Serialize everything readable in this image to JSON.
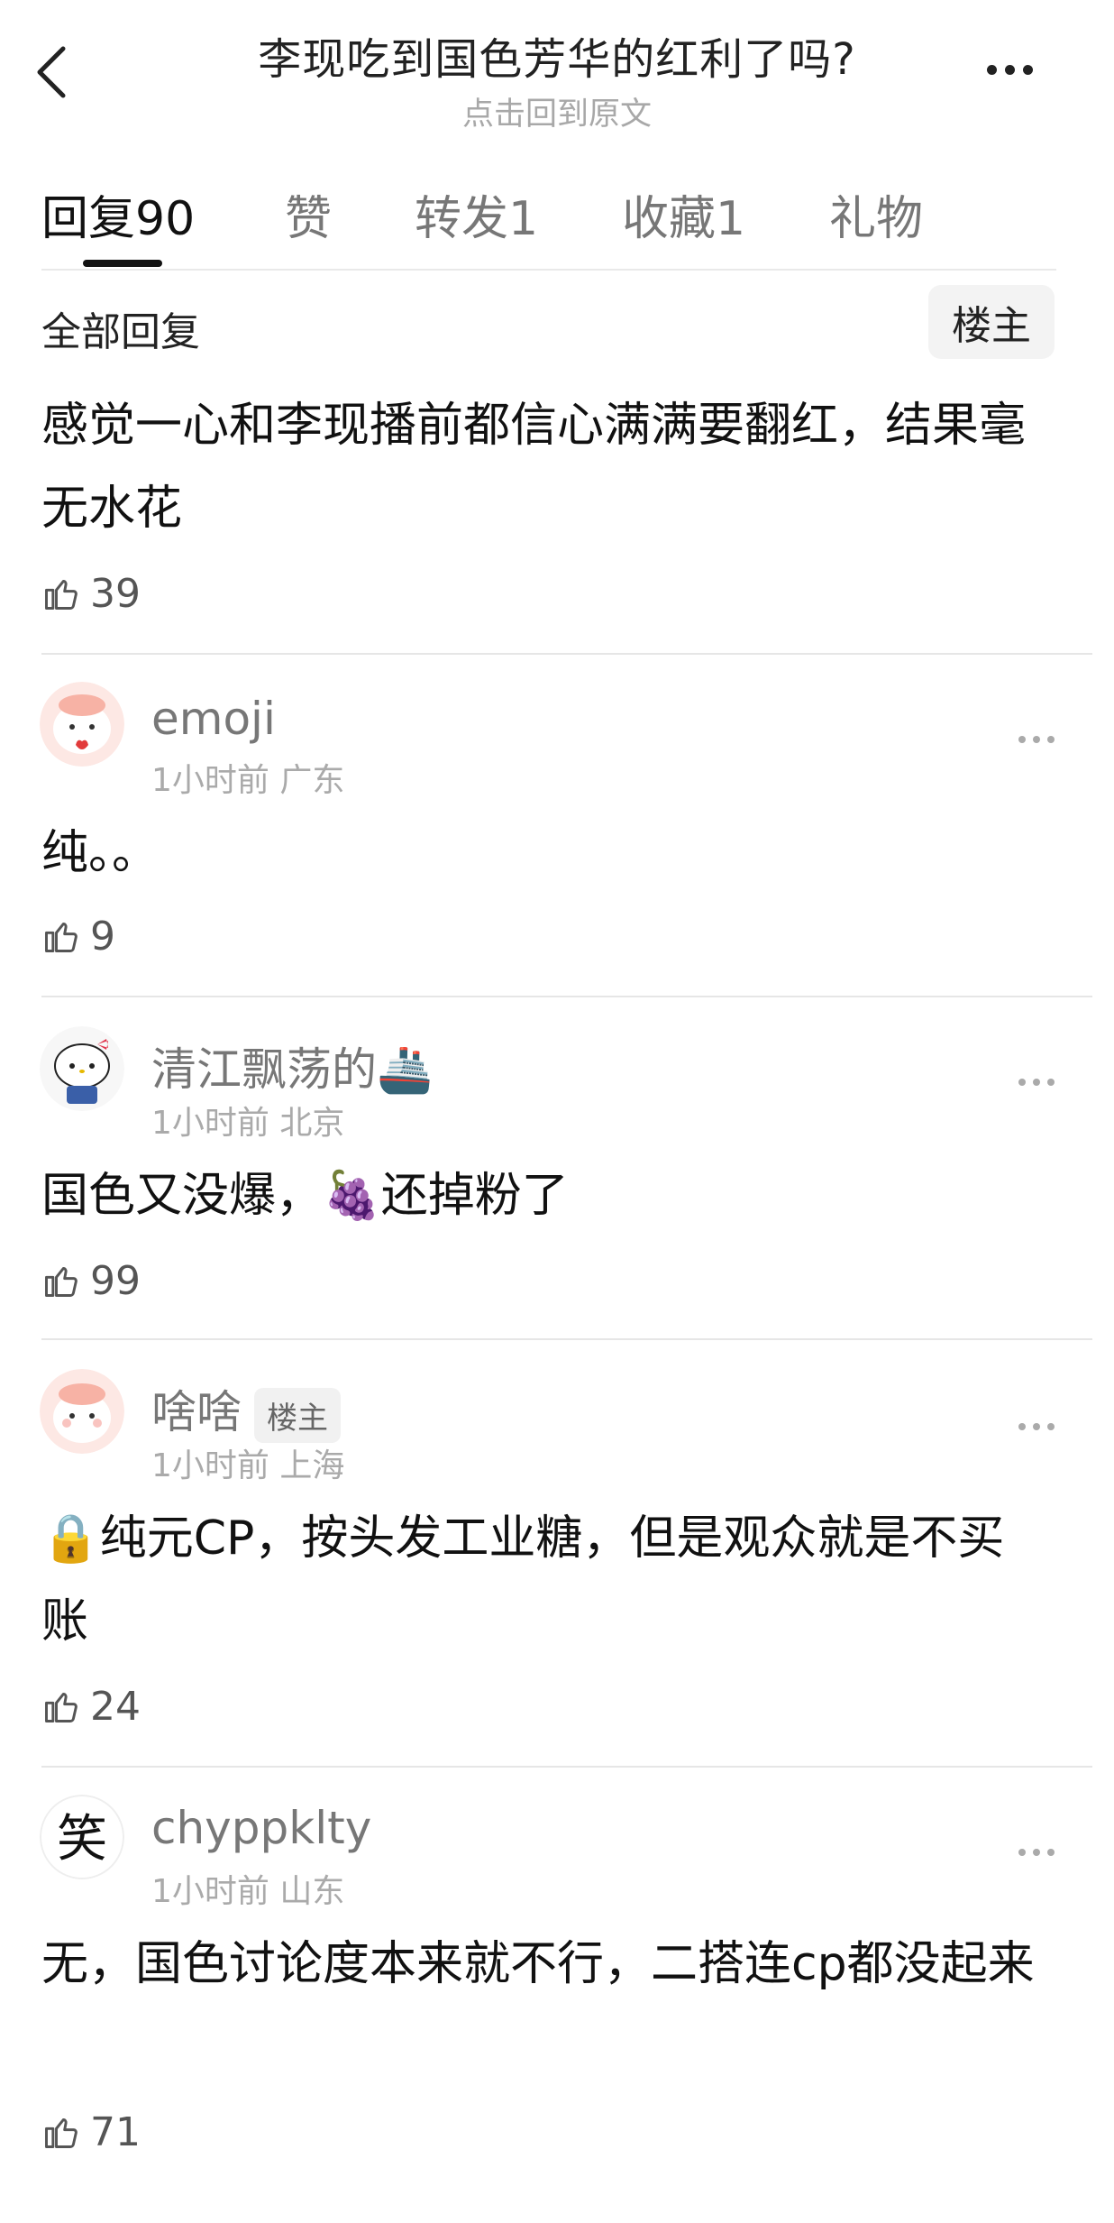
{
  "header": {
    "title": "李现吃到国色芳华的红利了吗?",
    "subtitle": "点击回到原文"
  },
  "tabs": [
    {
      "label": "回复90",
      "active": true
    },
    {
      "label": "赞",
      "active": false
    },
    {
      "label": "转发1",
      "active": false
    },
    {
      "label": "收藏1",
      "active": false
    },
    {
      "label": "礼物",
      "active": false
    }
  ],
  "filter": {
    "all_replies": "全部回复",
    "owner_only": "楼主"
  },
  "post": {
    "text": "感觉一心和李现播前都信心满满要翻红，结果毫无水花",
    "likes": "39"
  },
  "comments": [
    {
      "username": "emoji",
      "time": "1小时前",
      "location": "广东",
      "text": "纯。。",
      "likes": "9",
      "badge": ""
    },
    {
      "username": "清江飘荡的🚢",
      "time": "1小时前",
      "location": "北京",
      "text": "国色又没爆，🍇还掉粉了",
      "likes": "99",
      "badge": ""
    },
    {
      "username": "啥啥",
      "time": "1小时前",
      "location": "上海",
      "text": "🔒纯元CP，按头发工业糖，但是观众就是不买账",
      "likes": "24",
      "badge": "楼主"
    },
    {
      "username": "chyppklty",
      "time": "1小时前",
      "location": "山东",
      "text": "无，国色讨论度本来就不行，二搭连cp都没起来",
      "likes": "71",
      "badge": ""
    }
  ],
  "colors": {
    "accent": "#111111",
    "muted": "#aaaaaa",
    "divider": "#e6e6e6"
  }
}
